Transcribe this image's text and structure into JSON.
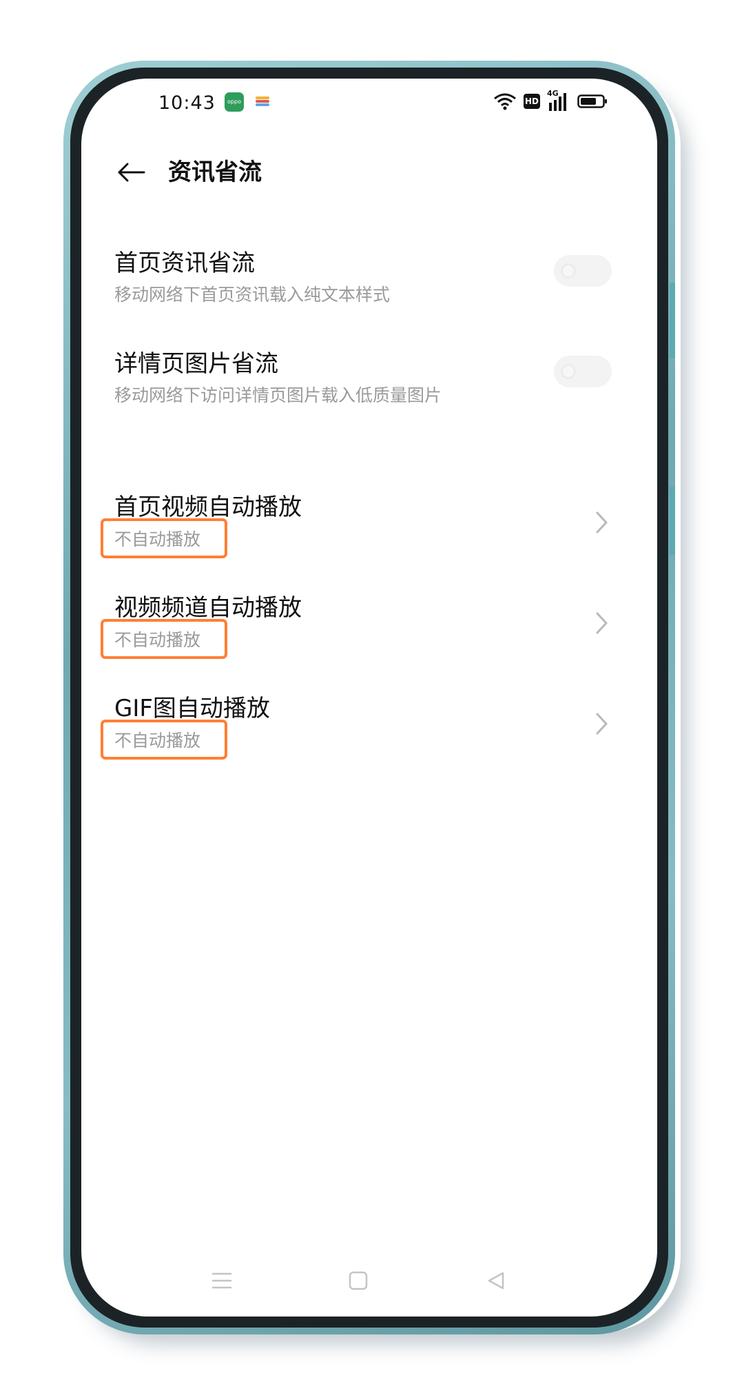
{
  "status_bar": {
    "time": "10:43",
    "oppo_badge": "oppo",
    "icons": [
      "app-notification-icon",
      "wifi-icon",
      "hd-icon",
      "4g-signal-icon",
      "battery-icon"
    ],
    "hd_label": "HD",
    "network_label": "4G"
  },
  "app_bar": {
    "back_icon": "arrow-left-icon",
    "title": "资讯省流"
  },
  "settings": {
    "home_news_saver": {
      "title": "首页资讯省流",
      "subtitle": "移动网络下首页资讯载入纯文本样式",
      "enabled": false
    },
    "detail_image_saver": {
      "title": "详情页图片省流",
      "subtitle": "移动网络下访问详情页图片载入低质量图片",
      "enabled": false
    },
    "home_video_autoplay": {
      "title": "首页视频自动播放",
      "value": "不自动播放"
    },
    "video_channel_autoplay": {
      "title": "视频频道自动播放",
      "value": "不自动播放"
    },
    "gif_autoplay": {
      "title": "GIF图自动播放",
      "value": "不自动播放"
    }
  },
  "colors": {
    "highlight": "#ff7f36",
    "frame": "#7fb6be",
    "subtitle": "#9a9a9a"
  },
  "nav_bar": {
    "icons": [
      "menu-icon",
      "home-square-icon",
      "back-triangle-icon"
    ]
  }
}
